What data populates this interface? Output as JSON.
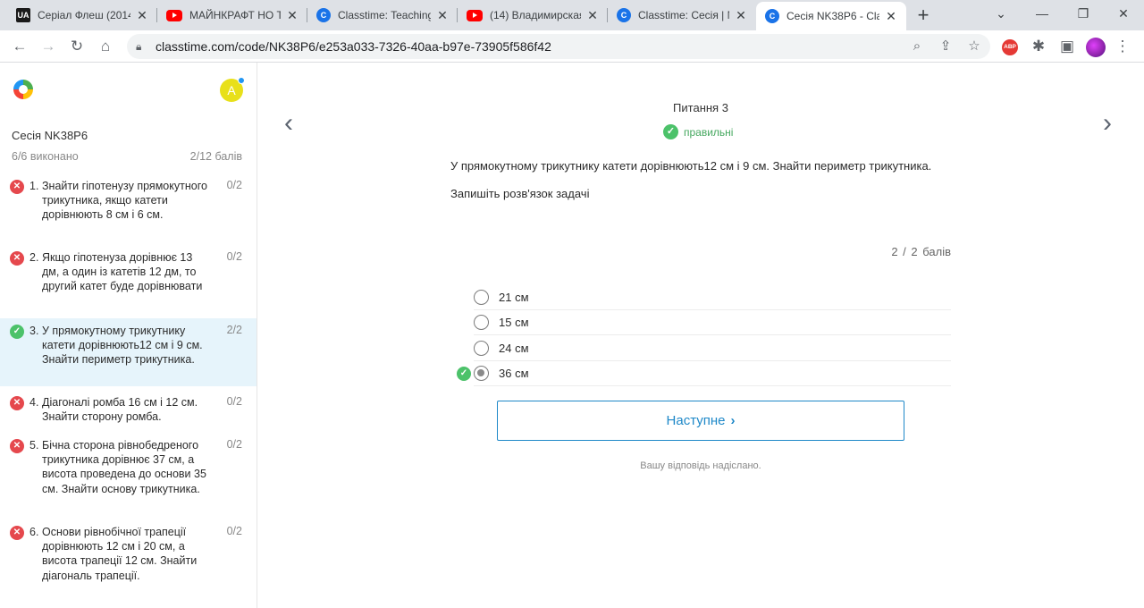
{
  "browser": {
    "tabs": [
      {
        "title": "Серіал Флеш (2014",
        "icon": "ua-icon",
        "favicon_text": "UA"
      },
      {
        "title": "МАЙНКРАФТ НО Т",
        "icon": "youtube-icon"
      },
      {
        "title": "Classtime: Teaching",
        "icon": "classtime-icon"
      },
      {
        "title": "(14) Владимирская",
        "icon": "youtube-icon"
      },
      {
        "title": "Classtime: Сесія | N",
        "icon": "classtime-icon"
      },
      {
        "title": "Сесія NK38P6 - Cla",
        "icon": "classtime-icon",
        "active": true
      }
    ],
    "url": "classtime.com/code/NK38P6/e253a033-7326-40aa-b97e-73905f586f42",
    "extension_label": "ABP"
  },
  "sidebar": {
    "avatar_letter": "A",
    "session_title": "Сесія NK38P6",
    "progress": "6/6 виконано",
    "points": "2/12 балів",
    "questions": [
      {
        "num": "1.",
        "text": "Знайти гіпотенузу прямокутного трикутника, якщо катети дорівнюють 8 см і 6 см.",
        "score": "0/2",
        "status": "wrong"
      },
      {
        "num": "2.",
        "text": "Якщо гіпотенуза дорівнює 13 дм, а один із катетів 12 дм, то другий катет буде дорівнювати",
        "score": "0/2",
        "status": "wrong"
      },
      {
        "num": "3.",
        "text": "У прямокутному трикутнику катети дорівнюють12 см і 9 см. Знайти периметр трикутника.",
        "score": "2/2",
        "status": "correct"
      },
      {
        "num": "4.",
        "text": "Діагоналі ромба 16 см і 12 см. Знайти сторону ромба.",
        "score": "0/2",
        "status": "wrong"
      },
      {
        "num": "5.",
        "text": "Бічна сторона рівнобедреного трикутника дорівнює 37 см, а висота проведена до основи 35 см. Знайти основу трикутника.",
        "score": "0/2",
        "status": "wrong"
      },
      {
        "num": "6.",
        "text": "Основи рівнобічної трапеції дорівнюють 12 см і 20 см, а висота трапеції 12 см. Знайти діагональ трапеції.",
        "score": "0/2",
        "status": "wrong"
      }
    ]
  },
  "main": {
    "question_title": "Питання 3",
    "status_label": "правильні",
    "question_text": "У прямокутному трикутнику катети дорівнюють12 см і 9 см. Знайти периметр трикутника.",
    "instruction": "Запишіть розв'язок задачі",
    "score": "2 / 2 балів",
    "options": [
      {
        "label": "21 см",
        "selected": false,
        "correct": false
      },
      {
        "label": "15 см",
        "selected": false,
        "correct": false
      },
      {
        "label": "24 см",
        "selected": false,
        "correct": false
      },
      {
        "label": "36 см",
        "selected": true,
        "correct": true
      }
    ],
    "next_label": "Наступне",
    "submitted_note": "Вашу відповідь надіслано."
  },
  "colors": {
    "accent": "#1e88c8",
    "correct": "#4cc26a",
    "wrong": "#e5484d",
    "selected_row": "#e6f4fb"
  }
}
